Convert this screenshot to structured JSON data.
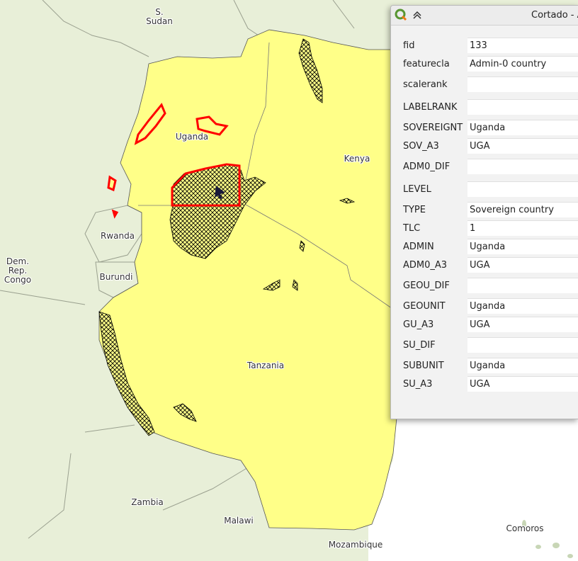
{
  "map": {
    "colors": {
      "background": "#e8efd8",
      "selected_fill": "#ffff88",
      "neighbor_fill": "#dfe9cc",
      "ocean": "#ffffff",
      "highlight": "#ff0000"
    },
    "labels": [
      {
        "id": "s-sudan",
        "text": "S.\nSudan"
      },
      {
        "id": "uganda",
        "text": "Uganda"
      },
      {
        "id": "kenya",
        "text": "Kenya"
      },
      {
        "id": "rwanda",
        "text": "Rwanda"
      },
      {
        "id": "drc",
        "text": "Dem.\nRep.\nCongo"
      },
      {
        "id": "burundi",
        "text": "Burundi"
      },
      {
        "id": "tanzania",
        "text": "Tanzania"
      },
      {
        "id": "zambia",
        "text": "Zambia"
      },
      {
        "id": "malawi",
        "text": "Malawi"
      },
      {
        "id": "mozambique",
        "text": "Mozambique"
      },
      {
        "id": "comoros",
        "text": "Comoros"
      }
    ]
  },
  "dialog": {
    "title": "Cortado - A",
    "fields": [
      {
        "key": "fid",
        "value": "133"
      },
      {
        "key": "featurecla",
        "value": "Admin-0 country"
      },
      {
        "key": "scalerank",
        "value": ""
      },
      {
        "key": "LABELRANK",
        "value": ""
      },
      {
        "key": "SOVEREIGNT",
        "value": "Uganda"
      },
      {
        "key": "SOV_A3",
        "value": "UGA"
      },
      {
        "key": "ADM0_DIF",
        "value": ""
      },
      {
        "key": "LEVEL",
        "value": ""
      },
      {
        "key": "TYPE",
        "value": "Sovereign country"
      },
      {
        "key": "TLC",
        "value": "1"
      },
      {
        "key": "ADMIN",
        "value": "Uganda"
      },
      {
        "key": "ADM0_A3",
        "value": "UGA"
      },
      {
        "key": "GEOU_DIF",
        "value": ""
      },
      {
        "key": "GEOUNIT",
        "value": "Uganda"
      },
      {
        "key": "GU_A3",
        "value": "UGA"
      },
      {
        "key": "SU_DIF",
        "value": ""
      },
      {
        "key": "SUBUNIT",
        "value": "Uganda"
      },
      {
        "key": "SU_A3",
        "value": "UGA"
      }
    ]
  }
}
